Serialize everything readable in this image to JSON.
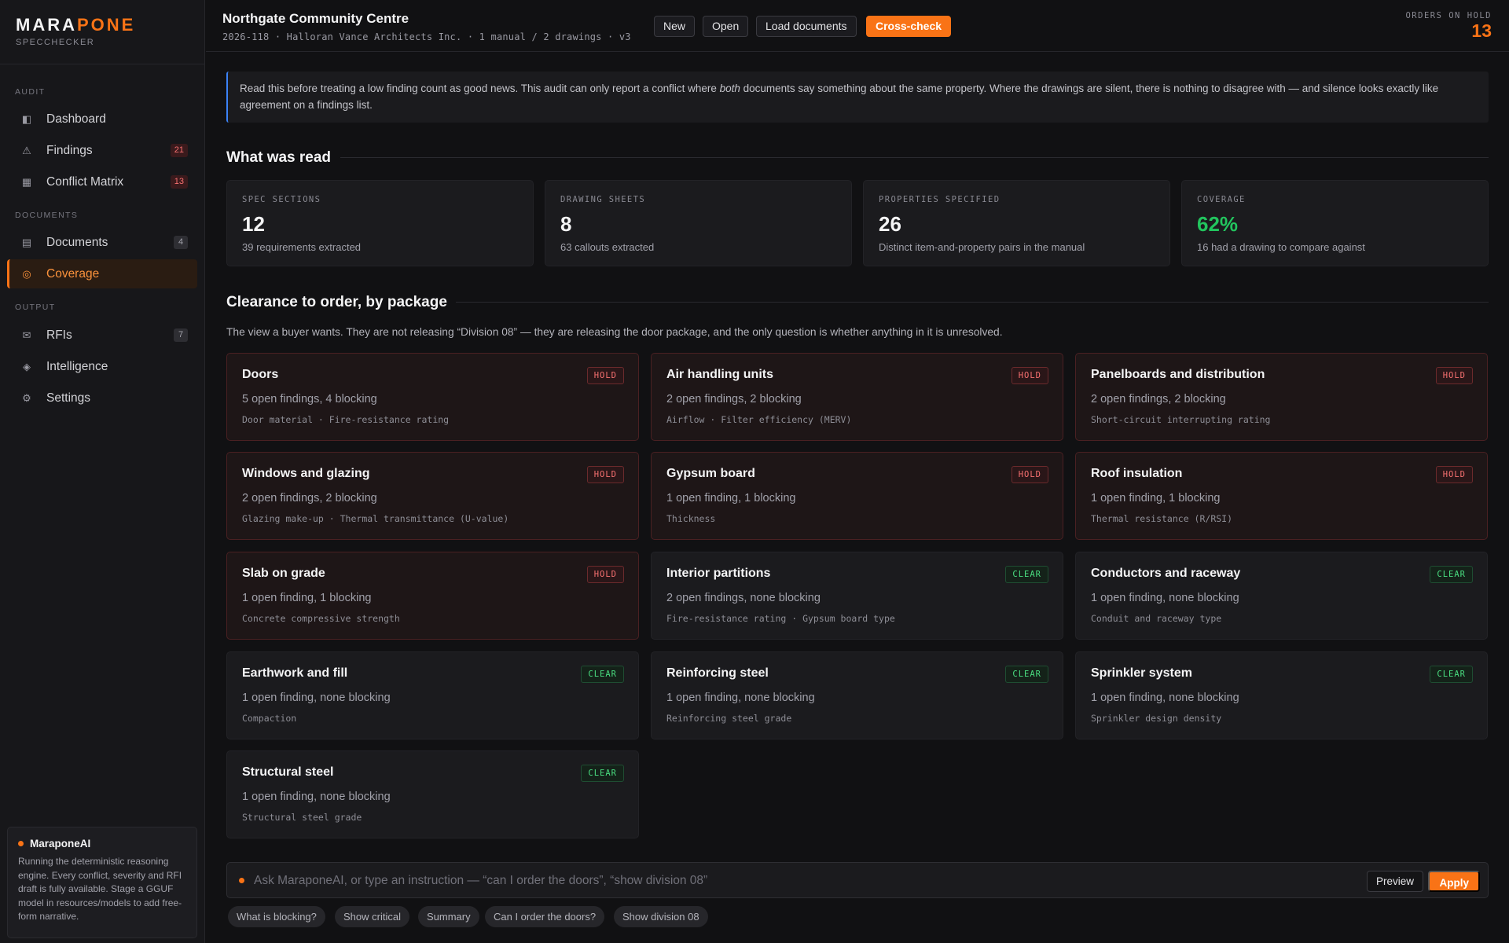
{
  "brand": {
    "logo_a": "MARA",
    "logo_b": "PONE",
    "sub": "SPECCHECKER"
  },
  "nav": {
    "audit_label": "AUDIT",
    "documents_label": "DOCUMENTS",
    "output_label": "OUTPUT",
    "items": [
      {
        "label": "Dashboard",
        "icon": "dashboard-icon",
        "badge": ""
      },
      {
        "label": "Findings",
        "icon": "warning-icon",
        "badge": "21"
      },
      {
        "label": "Conflict Matrix",
        "icon": "grid-icon",
        "badge": "13"
      },
      {
        "label": "Documents",
        "icon": "document-icon",
        "badge": "4"
      },
      {
        "label": "Coverage",
        "icon": "target-icon",
        "badge": "",
        "active": true
      },
      {
        "label": "RFIs",
        "icon": "mail-icon",
        "badge": "7"
      },
      {
        "label": "Intelligence",
        "icon": "diamond-icon",
        "badge": ""
      },
      {
        "label": "Settings",
        "icon": "gear-icon",
        "badge": ""
      }
    ]
  },
  "ai": {
    "title": "MaraponeAI",
    "text": "Running the deterministic reasoning engine. Every conflict, severity and RFI draft is fully available. Stage a GGUF model in resources/models to add free-form narrative."
  },
  "header": {
    "title": "Northgate Community Centre",
    "meta": "2026-118 · Halloran Vance Architects Inc. · 1 manual / 2 drawings · v3",
    "buttons": {
      "new": "New",
      "open": "Open",
      "load": "Load documents",
      "cross": "Cross-check"
    },
    "hold_label": "ORDERS ON HOLD",
    "hold_count": "13"
  },
  "notice": {
    "before": "Read this before treating a low finding count as good news. This audit can only report a conflict where ",
    "em": "both",
    "after": " documents say something about the same property. Where the drawings are silent, there is nothing to disagree with — and silence looks exactly like agreement on a findings list."
  },
  "read": {
    "heading": "What was read",
    "stats": [
      {
        "key": "SPEC SECTIONS",
        "value": "12",
        "sub": "39 requirements extracted"
      },
      {
        "key": "DRAWING SHEETS",
        "value": "8",
        "sub": "63 callouts extracted"
      },
      {
        "key": "PROPERTIES SPECIFIED",
        "value": "26",
        "sub": "Distinct item-and-property pairs in the manual"
      },
      {
        "key": "COVERAGE",
        "value": "62%",
        "sub": "16 had a drawing to compare against"
      }
    ]
  },
  "clearance": {
    "heading": "Clearance to order, by package",
    "lead": "The view a buyer wants. They are not releasing “Division 08” — they are releasing the door package, and the only question is whether anything in it is unresolved.",
    "packages": [
      {
        "title": "Doors",
        "status": "HOLD",
        "count": "5 open findings, 4 blocking",
        "props": "Door material · Fire-resistance rating"
      },
      {
        "title": "Air handling units",
        "status": "HOLD",
        "count": "2 open findings, 2 blocking",
        "props": "Airflow · Filter efficiency (MERV)"
      },
      {
        "title": "Panelboards and distribution",
        "status": "HOLD",
        "count": "2 open findings, 2 blocking",
        "props": "Short-circuit interrupting rating"
      },
      {
        "title": "Windows and glazing",
        "status": "HOLD",
        "count": "2 open findings, 2 blocking",
        "props": "Glazing make-up · Thermal transmittance (U-value)"
      },
      {
        "title": "Gypsum board",
        "status": "HOLD",
        "count": "1 open finding, 1 blocking",
        "props": "Thickness"
      },
      {
        "title": "Roof insulation",
        "status": "HOLD",
        "count": "1 open finding, 1 blocking",
        "props": "Thermal resistance (R/RSI)"
      },
      {
        "title": "Slab on grade",
        "status": "HOLD",
        "count": "1 open finding, 1 blocking",
        "props": "Concrete compressive strength"
      },
      {
        "title": "Interior partitions",
        "status": "CLEAR",
        "count": "2 open findings, none blocking",
        "props": "Fire-resistance rating · Gypsum board type"
      },
      {
        "title": "Conductors and raceway",
        "status": "CLEAR",
        "count": "1 open finding, none blocking",
        "props": "Conduit and raceway type"
      },
      {
        "title": "Earthwork and fill",
        "status": "CLEAR",
        "count": "1 open finding, none blocking",
        "props": "Compaction"
      },
      {
        "title": "Reinforcing steel",
        "status": "CLEAR",
        "count": "1 open finding, none blocking",
        "props": "Reinforcing steel grade"
      },
      {
        "title": "Sprinkler system",
        "status": "CLEAR",
        "count": "1 open finding, none blocking",
        "props": "Sprinkler design density"
      },
      {
        "title": "Structural steel",
        "status": "CLEAR",
        "count": "1 open finding, none blocking",
        "props": "Structural steel grade"
      }
    ]
  },
  "ask": {
    "placeholder": "Ask MaraponeAI, or type an instruction — “can I order the doors”, “show division 08”",
    "preview": "Preview",
    "apply": "Apply",
    "chips": [
      "What is blocking?",
      "Show critical",
      "Summary",
      "Can I order the doors?",
      "Show division 08"
    ]
  },
  "colors": {
    "accent": "#f97316",
    "hold": "#f87171",
    "clear": "#4ade80",
    "info": "#3b82f6",
    "coverage": "#22c55e"
  }
}
